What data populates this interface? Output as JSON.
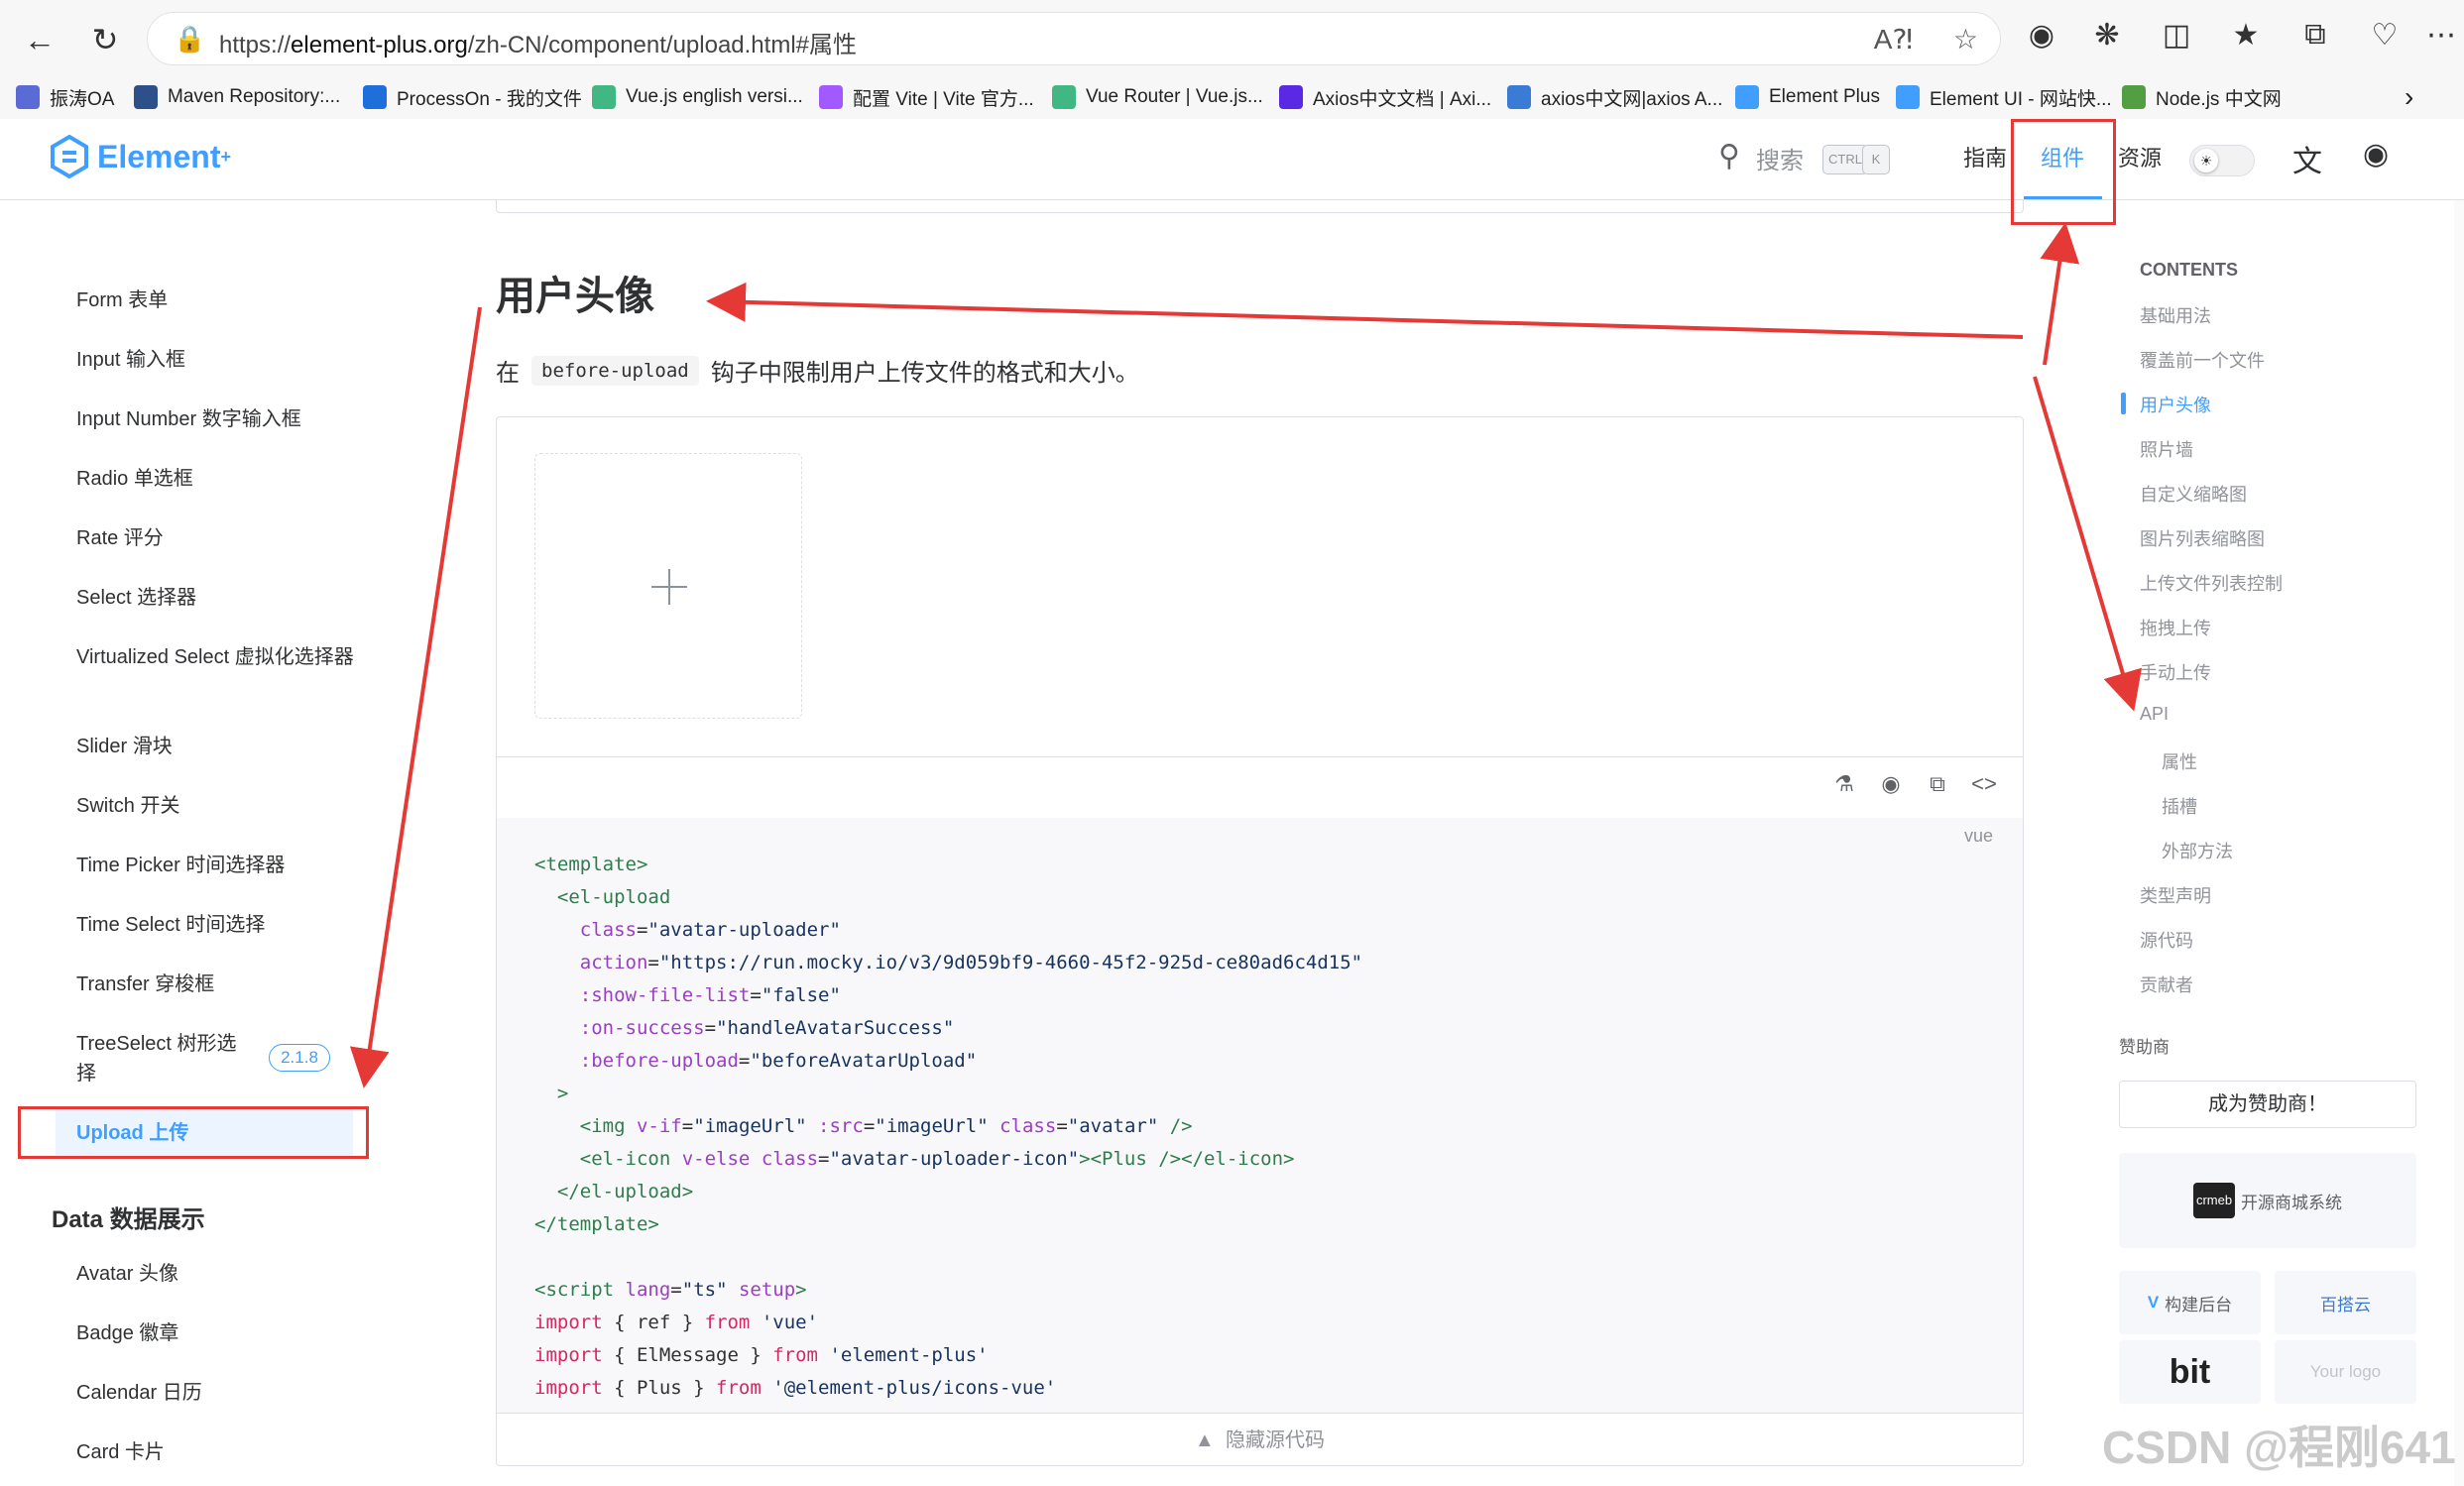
{
  "browser": {
    "url_prefix": "https://",
    "url_domain": "element-plus.org",
    "url_rest": "/zh-CN/component/upload.html#属性",
    "bookmarks": [
      {
        "label": "振涛OA",
        "color": "#5b6bd6"
      },
      {
        "label": "Maven Repository:...",
        "color": "#2d4f8a"
      },
      {
        "label": "ProcessOn - 我的文件",
        "color": "#1e6fd9"
      },
      {
        "label": "Vue.js english versi...",
        "color": "#41b883"
      },
      {
        "label": "配置 Vite | Vite 官方...",
        "color": "#a259ff"
      },
      {
        "label": "Vue Router | Vue.js...",
        "color": "#41b883"
      },
      {
        "label": "Axios中文文档 | Axi...",
        "color": "#5a29e4"
      },
      {
        "label": "axios中文网|axios A...",
        "color": "#3a7bd5"
      },
      {
        "label": "Element Plus",
        "color": "#409eff"
      },
      {
        "label": "Element UI - 网站快...",
        "color": "#409eff"
      },
      {
        "label": "Node.js 中文网",
        "color": "#539e43"
      }
    ]
  },
  "site": {
    "logo": "Element",
    "logo_sup": "+",
    "search": "搜索",
    "kbd_ctrl": "CTRL",
    "kbd_k": "K",
    "nav": [
      "指南",
      "组件",
      "资源"
    ],
    "accent": "#409eff"
  },
  "sidebar": {
    "items": [
      "Form 表单",
      "Input 输入框",
      "Input Number 数字输入框",
      "Radio 单选框",
      "Rate 评分",
      "Select 选择器",
      "Virtualized Select 虚拟化选择器",
      "Slider 滑块",
      "Switch 开关",
      "Time Picker 时间选择器",
      "Time Select 时间选择",
      "Transfer 穿梭框",
      "TreeSelect 树形选择",
      "Upload 上传"
    ],
    "treeselect_badge": "2.1.8",
    "group": "Data 数据展示",
    "group_items": [
      "Avatar 头像",
      "Badge 徽章",
      "Calendar 日历",
      "Card 卡片"
    ]
  },
  "content": {
    "title": "用户头像",
    "desc_pre": "在",
    "desc_code": "before-upload",
    "desc_post": "钩子中限制用户上传文件的格式和大小。",
    "code_lang": "vue",
    "hide_code": "隐藏源代码"
  },
  "toc": {
    "heading": "CONTENTS",
    "items": [
      "基础用法",
      "覆盖前一个文件",
      "用户头像",
      "照片墙",
      "自定义缩略图",
      "图片列表缩略图",
      "上传文件列表控制",
      "拖拽上传",
      "手动上传",
      "API"
    ],
    "api_items": [
      "属性",
      "插槽",
      "外部方法"
    ],
    "tail_items": [
      "类型声明",
      "源代码",
      "贡献者"
    ],
    "sponsor_label": "赞助商",
    "sponsor_button": "成为赞助商！",
    "sponsors": [
      "开源商城系统",
      "构建后台",
      "百搭云",
      "bit",
      "Your logo"
    ]
  },
  "watermark": "CSDN @程刚641"
}
